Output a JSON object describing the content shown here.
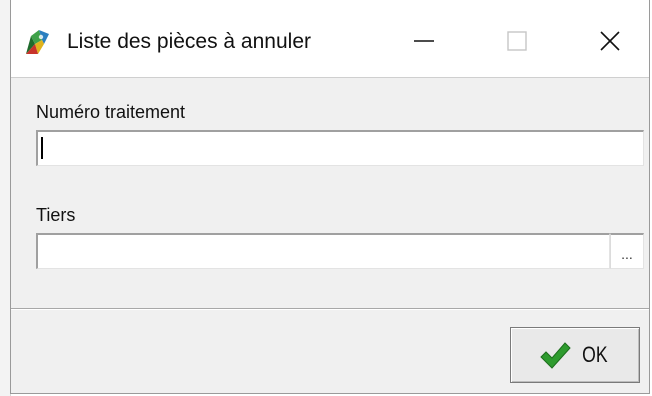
{
  "window": {
    "title": "Liste des pièces à annuler",
    "caption_buttons": {
      "minimize": "—",
      "close": "✕"
    }
  },
  "form": {
    "numero_traitement": {
      "label": "Numéro traitement",
      "value": ""
    },
    "tiers": {
      "label": "Tiers",
      "value": "",
      "browse_label": "..."
    }
  },
  "actions": {
    "ok_label": "OK"
  },
  "icons": {
    "app": "colorful-app-icon",
    "ok": "green-check-icon"
  },
  "colors": {
    "check_green": "#2e9b2e",
    "window_bg": "#f0f0f0"
  }
}
